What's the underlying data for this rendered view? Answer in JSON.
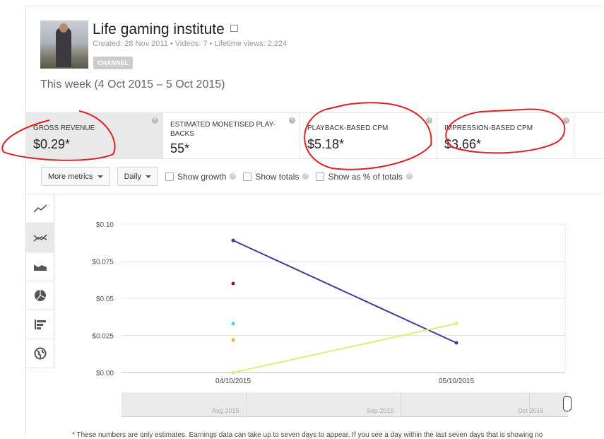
{
  "channel": {
    "name": "Life gaming institute",
    "created": "Created: 28 Nov 2011",
    "videos": "Videos: 7",
    "lifetime_views": "Lifetime views: 2,224",
    "badge": "CHANNEL",
    "sep": "•"
  },
  "period": "This week (4 Oct 2015 – 5 Oct 2015)",
  "metrics": [
    {
      "label": "GROSS REVENUE",
      "value": "$0.29*",
      "selected": true
    },
    {
      "label": "ESTIMATED MONETISED PLAY-BACKS",
      "value": "55*"
    },
    {
      "label": "PLAYBACK-BASED CPM",
      "value": "$5.18*"
    },
    {
      "label": "IMPRESSION-BASED CPM",
      "value": "$3.66*"
    }
  ],
  "controls": {
    "more_metrics": "More metrics",
    "interval": "Daily",
    "show_growth": "Show growth",
    "show_totals": "Show totals",
    "show_pct": "Show as % of totals",
    "help": "?"
  },
  "chart_icons": [
    "line-chart-icon",
    "multiline-chart-icon",
    "stacked-area-icon",
    "pie-chart-icon",
    "bar-chart-icon",
    "map-icon"
  ],
  "chart_data": {
    "type": "line",
    "categories": [
      "04/10/2015",
      "05/10/2015"
    ],
    "ylim": [
      0,
      0.1
    ],
    "yticks": [
      "$0.00",
      "$0.025",
      "$0.05",
      "$0.075",
      "$0.10"
    ],
    "grid": true,
    "series": [
      {
        "color": "#3f3a9a",
        "values": [
          0.089,
          0.02
        ]
      },
      {
        "color": "#d4f27a",
        "values": [
          0.0,
          0.033
        ]
      },
      {
        "color": "#8b1a1a",
        "values": [
          0.06,
          null
        ]
      },
      {
        "color": "#4fd0dc",
        "values": [
          0.033,
          null
        ]
      },
      {
        "color": "#f0b429",
        "values": [
          0.022,
          null
        ]
      }
    ]
  },
  "navigator": {
    "labels": [
      "Aug 2015",
      "Sep 2015",
      "Oct 2015"
    ]
  },
  "footnote": "* These numbers are only estimates. Earnings data can take up to seven days to appear. If you see a day within the last seven days that is showing no",
  "annotation_color": "#e02020"
}
